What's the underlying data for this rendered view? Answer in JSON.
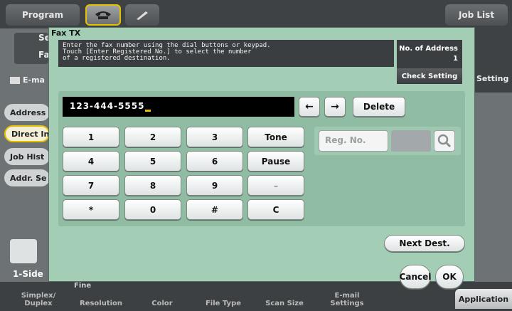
{
  "header": {
    "tab_program": "Program",
    "tab_phone_icon": "phone-icon",
    "tab_pen_icon": "pen-icon",
    "tab_joblist": "Job List"
  },
  "background": {
    "side_items": [
      "Address",
      "Direct In",
      "Job Hist",
      "Addr. Se"
    ],
    "copy_mode": "1-Side",
    "bg_title_fragment": "Se",
    "bg_fax_fragment": "Fa",
    "bg_email_fragment": "E-ma",
    "bg_setting": "Setting",
    "bottom_tabs": [
      "Simplex/\nDuplex",
      "Resolution",
      "Color",
      "File Type",
      "Scan Size",
      "E-mail\nSettings"
    ],
    "resolution_value": "Fine",
    "application": "Application"
  },
  "modal": {
    "title": "Fax TX",
    "message": "Enter the fax number using the dial buttons or keypad.\nTouch [Enter Registered No.] to select the number\nof a registered destination.",
    "address_label": "No. of Address",
    "address_count": "1",
    "check_setting": "Check Setting",
    "number": "123-444-5555",
    "arrow_left": "←",
    "arrow_right": "→",
    "delete": "Delete",
    "keypad": [
      "1",
      "2",
      "3",
      "Tone",
      "4",
      "5",
      "6",
      "Pause",
      "7",
      "8",
      "9",
      "–",
      "*",
      "0",
      "#",
      "C"
    ],
    "reg_no_placeholder": "Reg. No.",
    "search_icon": "search-icon",
    "next_dest": "Next Dest.",
    "cancel": "Cancel",
    "ok": "OK"
  }
}
